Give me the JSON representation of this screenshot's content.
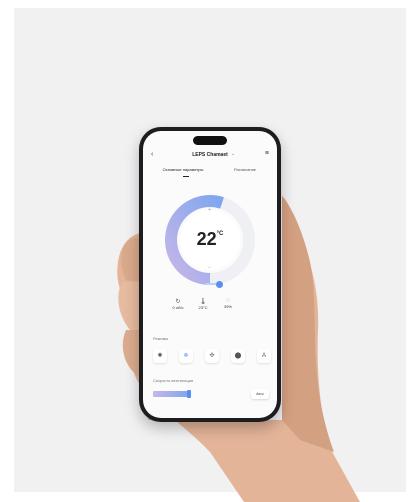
{
  "header": {
    "title": "LEPS Chamaet"
  },
  "tabs": [
    {
      "label": "Основные параметры"
    },
    {
      "label": "Расписание"
    }
  ],
  "thermostat": {
    "temperature": "22",
    "unit": "°C",
    "setpoint_fraction": 0.55
  },
  "stats": [
    {
      "icon": "fan-icon",
      "value": "0 об/с"
    },
    {
      "icon": "thermometer-icon",
      "value": "23°C"
    },
    {
      "icon": "humidity-icon",
      "value": "39%"
    }
  ],
  "modes_section": {
    "label": "Режимы"
  },
  "modes": [
    {
      "icon": "sun-icon",
      "glyph": "✺"
    },
    {
      "icon": "snow-icon",
      "glyph": "❄"
    },
    {
      "icon": "heat-icon",
      "glyph": "✣"
    },
    {
      "icon": "drop-icon",
      "glyph": "⬤"
    },
    {
      "icon": "auto-icon",
      "glyph": "A"
    }
  ],
  "schedule": {
    "label": "Скорость вентиляции",
    "button": "Авто"
  },
  "colors": {
    "accent": "#5b8def",
    "arc_start": "#c7b6e8",
    "arc_end": "#7fa6ee"
  }
}
